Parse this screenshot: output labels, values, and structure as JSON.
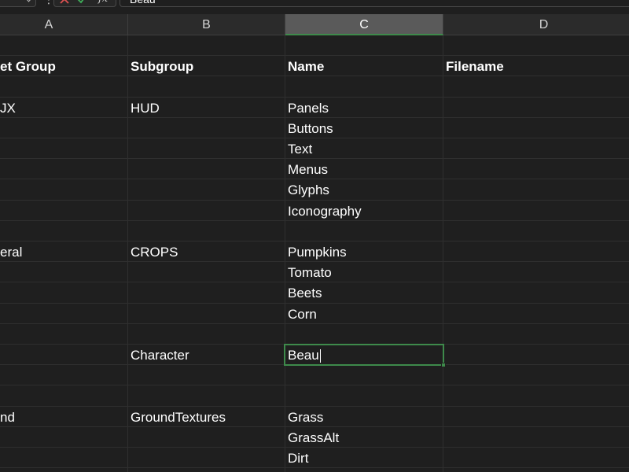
{
  "formula_bar": {
    "cancel_icon": "cross-icon",
    "enter_icon": "check-icon",
    "fx_label": "fx",
    "value": "Beau"
  },
  "columns": [
    {
      "id": "A",
      "label": "A"
    },
    {
      "id": "B",
      "label": "B"
    },
    {
      "id": "C",
      "label": "C"
    },
    {
      "id": "D",
      "label": "D"
    }
  ],
  "selected_column": "C",
  "headers": {
    "a": "et Group",
    "b": "Subgroup",
    "c": "Name",
    "d": "Filename"
  },
  "rows": [
    {
      "a": "",
      "b": "",
      "c": ""
    },
    {
      "a": "et Group",
      "b": "Subgroup",
      "c": "Name",
      "d": "Filename",
      "bold": true
    },
    {
      "a": "",
      "b": "",
      "c": ""
    },
    {
      "a": "JX",
      "b": "HUD",
      "c": "Panels"
    },
    {
      "a": "",
      "b": "",
      "c": "Buttons"
    },
    {
      "a": "",
      "b": "",
      "c": "Text"
    },
    {
      "a": "",
      "b": "",
      "c": "Menus"
    },
    {
      "a": "",
      "b": "",
      "c": "Glyphs"
    },
    {
      "a": "",
      "b": "",
      "c": "Iconography"
    },
    {
      "a": "",
      "b": "",
      "c": ""
    },
    {
      "a": "eral",
      "b": "CROPS",
      "c": "Pumpkins"
    },
    {
      "a": "",
      "b": "",
      "c": "Tomato"
    },
    {
      "a": "",
      "b": "",
      "c": "Beets"
    },
    {
      "a": "",
      "b": "",
      "c": "Corn"
    },
    {
      "a": "",
      "b": "",
      "c": ""
    },
    {
      "a": "",
      "b": "Character",
      "c": "Beau",
      "active": true
    },
    {
      "a": "",
      "b": "",
      "c": ""
    },
    {
      "a": "",
      "b": "",
      "c": ""
    },
    {
      "a": "nd",
      "b": "GroundTextures",
      "c": "Grass"
    },
    {
      "a": "",
      "b": "",
      "c": "GrassAlt"
    },
    {
      "a": "",
      "b": "",
      "c": "Dirt"
    },
    {
      "a": "",
      "b": "",
      "c": ""
    }
  ],
  "colors": {
    "background": "#1f1f1f",
    "header_bg": "#2b2b2b",
    "selected_header_bg": "#5a5a5a",
    "accent": "#3e8a4b",
    "cancel_red": "#e05252",
    "enter_green": "#3fae5a"
  }
}
